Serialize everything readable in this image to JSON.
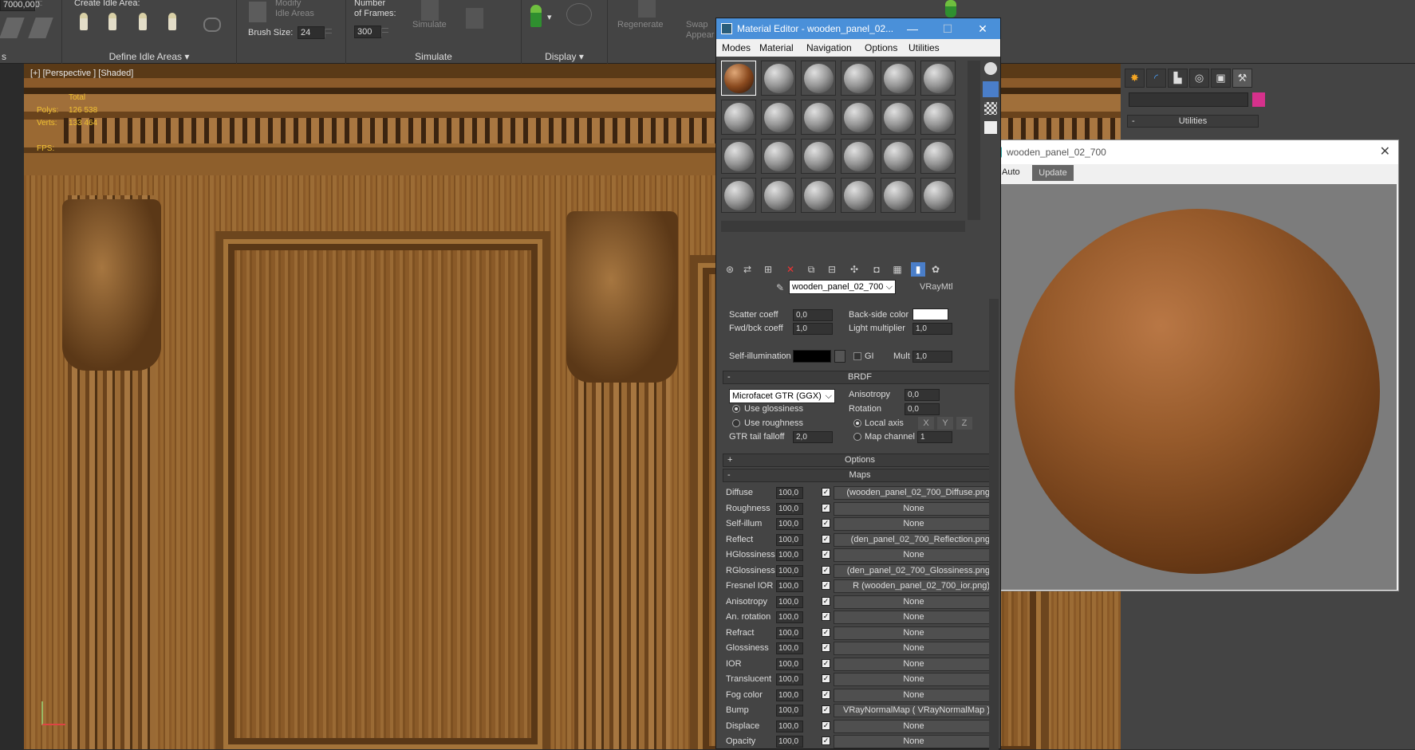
{
  "ribbon": {
    "partial_value": "7000,000",
    "create_idle_area": "Create Idle Area:",
    "modify_idle_areas": "Modify\nIdle Areas",
    "brush_size_label": "Brush Size:",
    "brush_size": "24",
    "number_of_frames": "Number\nof Frames:",
    "frames_value": "300",
    "simulate": "Simulate",
    "regenerate": "Regenerate",
    "swap_appear": "Swap\nAppear",
    "group_define": "Define Idle Areas",
    "group_simulate": "Simulate",
    "group_display": "Display",
    "group_left": "s"
  },
  "viewport": {
    "label": "[+] [Perspective ] [Shaded]",
    "total": "Total",
    "polys_label": "Polys:",
    "polys": "126 538",
    "verts_label": "Verts:",
    "verts": "133 464",
    "fps_label": "FPS:"
  },
  "material_editor": {
    "title": "Material Editor - wooden_panel_02...",
    "menu": [
      "Modes",
      "Material",
      "Navigation",
      "Options",
      "Utilities"
    ],
    "material_name": "wooden_panel_02_700",
    "material_type": "VRayMtl",
    "scatter_coeff_label": "Scatter coeff",
    "scatter_coeff": "0,0",
    "fwd_bck_label": "Fwd/bck coeff",
    "fwd_bck": "1,0",
    "back_side_color_label": "Back-side color",
    "light_multiplier_label": "Light multiplier",
    "light_multiplier": "1,0",
    "self_illum_label": "Self-illumination",
    "gi_label": "GI",
    "mult_label": "Mult",
    "mult": "1,0",
    "brdf_title": "BRDF",
    "brdf_type": "Microfacet GTR (GGX)",
    "anisotropy_label": "Anisotropy",
    "anisotropy": "0,0",
    "rotation_label": "Rotation",
    "rotation": "0,0",
    "use_glossiness": "Use glossiness",
    "use_roughness": "Use roughness",
    "local_axis": "Local axis",
    "axis_x": "X",
    "axis_y": "Y",
    "axis_z": "Z",
    "gtr_tail_label": "GTR tail falloff",
    "gtr_tail": "2,0",
    "map_channel_label": "Map channel",
    "map_channel": "1",
    "options_title": "Options",
    "maps_title": "Maps",
    "maps": [
      {
        "name": "Diffuse",
        "amount": "100,0",
        "map": "wooden_panel_02_700_Diffuse.png)"
      },
      {
        "name": "Roughness",
        "amount": "100,0",
        "map": "None"
      },
      {
        "name": "Self-illum",
        "amount": "100,0",
        "map": "None"
      },
      {
        "name": "Reflect",
        "amount": "100,0",
        "map": "den_panel_02_700_Reflection.png)"
      },
      {
        "name": "HGlossiness",
        "amount": "100,0",
        "map": "None"
      },
      {
        "name": "RGlossiness",
        "amount": "100,0",
        "map": "den_panel_02_700_Glossiness.png)"
      },
      {
        "name": "Fresnel IOR",
        "amount": "100,0",
        "map": "R (wooden_panel_02_700_ior.png)"
      },
      {
        "name": "Anisotropy",
        "amount": "100,0",
        "map": "None"
      },
      {
        "name": "An. rotation",
        "amount": "100,0",
        "map": "None"
      },
      {
        "name": "Refract",
        "amount": "100,0",
        "map": "None"
      },
      {
        "name": "Glossiness",
        "amount": "100,0",
        "map": "None"
      },
      {
        "name": "IOR",
        "amount": "100,0",
        "map": "None"
      },
      {
        "name": "Translucent",
        "amount": "100,0",
        "map": "None"
      },
      {
        "name": "Fog color",
        "amount": "100,0",
        "map": "None"
      },
      {
        "name": "Bump",
        "amount": "100,0",
        "map": "VRayNormalMap ( VRayNormalMap )"
      },
      {
        "name": "Displace",
        "amount": "100,0",
        "map": "None"
      },
      {
        "name": "Opacity",
        "amount": "100,0",
        "map": "None"
      }
    ]
  },
  "preview": {
    "title": "wooden_panel_02_700",
    "auto_label": "Auto",
    "update_label": "Update"
  },
  "command_panel": {
    "utilities_title": "Utilities"
  }
}
